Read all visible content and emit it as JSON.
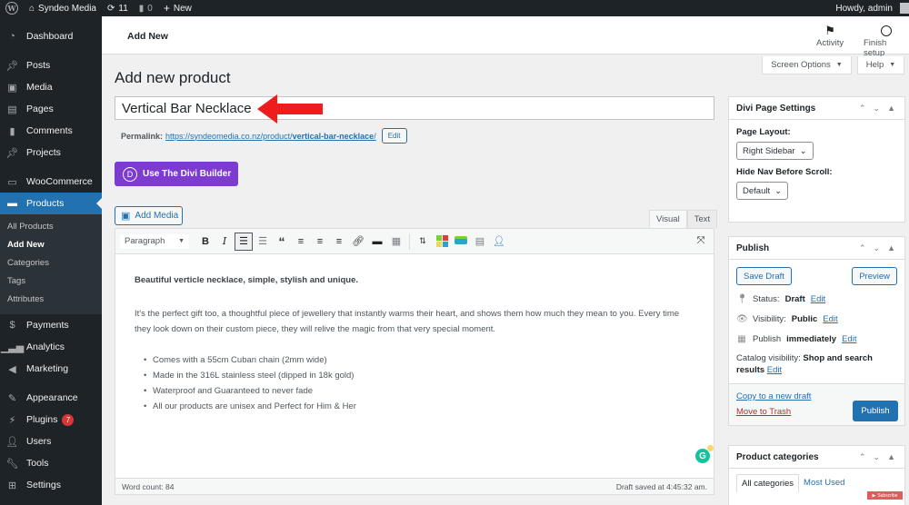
{
  "admin_bar": {
    "site_name": "Syndeo Media",
    "updates_count": "11",
    "comments_count": "0",
    "new_label": "New",
    "greeting": "Howdy, admin"
  },
  "sidebar": {
    "items": [
      {
        "label": "Dashboard",
        "icon": "dashboard-icon"
      },
      {
        "label": "Posts",
        "icon": "pin-icon"
      },
      {
        "label": "Media",
        "icon": "media-icon"
      },
      {
        "label": "Pages",
        "icon": "pages-icon"
      },
      {
        "label": "Comments",
        "icon": "comment-icon"
      },
      {
        "label": "Projects",
        "icon": "pin-icon"
      },
      {
        "label": "WooCommerce",
        "icon": "woocommerce-icon"
      },
      {
        "label": "Products",
        "icon": "archive-icon",
        "active": true
      },
      {
        "label": "Payments",
        "icon": "payment-icon"
      },
      {
        "label": "Analytics",
        "icon": "bar-chart-icon"
      },
      {
        "label": "Marketing",
        "icon": "megaphone-icon"
      },
      {
        "label": "Appearance",
        "icon": "brush-icon"
      },
      {
        "label": "Plugins",
        "icon": "plug-icon",
        "badge": "7"
      },
      {
        "label": "Users",
        "icon": "user-icon"
      },
      {
        "label": "Tools",
        "icon": "wrench-icon"
      },
      {
        "label": "Settings",
        "icon": "settings-icon"
      }
    ],
    "products_submenu": [
      "All Products",
      "Add New",
      "Categories",
      "Tags",
      "Attributes"
    ]
  },
  "header": {
    "title": "Add New",
    "activity_label": "Activity",
    "finish_setup_label": "Finish setup",
    "screen_options_label": "Screen Options",
    "help_label": "Help"
  },
  "main": {
    "page_title": "Add new product",
    "title_value": "Vertical Bar Necklace",
    "permalink_label": "Permalink:",
    "permalink_base": "https://syndeomedia.co.nz/product/",
    "permalink_slug": "vertical-bar-necklace",
    "permalink_trailing": "/",
    "permalink_edit": "Edit",
    "divi_button": "Use The Divi Builder",
    "divi_logo": "D",
    "add_media": "Add Media",
    "tabs": [
      "Visual",
      "Text"
    ],
    "format_select": "Paragraph",
    "content": {
      "lead": "Beautiful verticle necklace, simple, stylish and unique.",
      "paragraph": "It's the perfect gift too, a thoughtful piece of jewellery that instantly warms their heart, and shows them how much they mean to you. Every time they look down on their custom piece, they will relive the magic from that very special moment.",
      "bullets": [
        "Comes with a 55cm Cuban chain (2mm wide)",
        "Made in the 316L stainless steel (dipped in 18k gold)",
        "Waterproof and Guaranteed to never fade",
        "All our products are unisex and Perfect for Him & Her"
      ]
    },
    "word_count": "Word count: 84",
    "draft_saved": "Draft saved at 4:45:32 am."
  },
  "divi_settings": {
    "title": "Divi Page Settings",
    "page_layout_label": "Page Layout:",
    "page_layout_value": "Right Sidebar",
    "hide_nav_label": "Hide Nav Before Scroll:",
    "hide_nav_value": "Default"
  },
  "publish": {
    "title": "Publish",
    "save_draft": "Save Draft",
    "preview": "Preview",
    "status_label": "Status:",
    "status_value": "Draft",
    "visibility_label": "Visibility:",
    "visibility_value": "Public",
    "publish_label": "Publish",
    "publish_value": "immediately",
    "catalog_label": "Catalog visibility:",
    "catalog_value": "Shop and search results",
    "edit": "Edit",
    "copy_draft": "Copy to a new draft",
    "move_trash": "Move to Trash",
    "publish_button": "Publish"
  },
  "categories": {
    "title": "Product categories",
    "tabs": [
      "All categories",
      "Most Used"
    ]
  },
  "overlay": {
    "subscribe": "Subscribe",
    "arrow_color": "#ee1c1c"
  }
}
